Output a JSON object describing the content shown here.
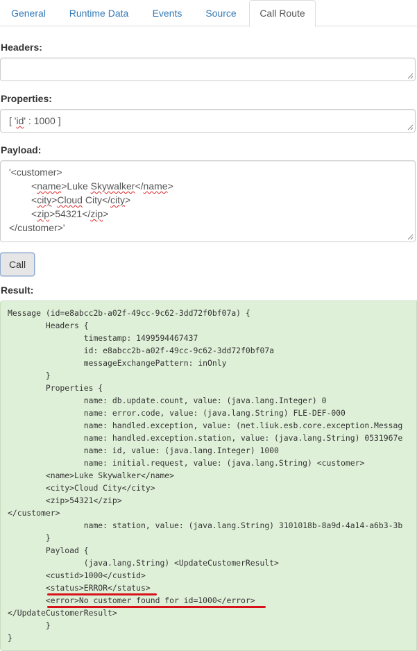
{
  "tabs": [
    {
      "label": "General"
    },
    {
      "label": "Runtime Data"
    },
    {
      "label": "Events"
    },
    {
      "label": "Source"
    },
    {
      "label": "Call Route"
    }
  ],
  "active_tab": "Call Route",
  "headers": {
    "label": "Headers:",
    "value": ""
  },
  "properties": {
    "label": "Properties:",
    "value_pre": "[ '",
    "value_key": "id",
    "value_post": "' : 1000 ]"
  },
  "payload": {
    "label": "Payload:",
    "lines": [
      [
        "'<customer>"
      ],
      [
        "<",
        "name",
        ">Luke ",
        "Skywalker",
        "</",
        "name",
        ">"
      ],
      [
        "<",
        "city",
        ">",
        "Cloud",
        " City</",
        "city",
        ">"
      ],
      [
        "<",
        "zip",
        ">54321</",
        "zip",
        ">"
      ],
      [
        "</customer>'"
      ]
    ]
  },
  "call_button": "Call",
  "result": {
    "label": "Result:",
    "lines": [
      "Message (id=e8abcc2b-a02f-49cc-9c62-3dd72f0bf07a) {",
      "        Headers {",
      "                timestamp: 1499594467437",
      "                id: e8abcc2b-a02f-49cc-9c62-3dd72f0bf07a",
      "                messageExchangePattern: inOnly",
      "        }",
      "        Properties {",
      "                name: db.update.count, value: (java.lang.Integer) 0",
      "                name: error.code, value: (java.lang.String) FLE-DEF-000",
      "                name: handled.exception, value: (net.liuk.esb.core.exception.Messag",
      "                name: handled.exception.station, value: (java.lang.String) 0531967e",
      "                name: id, value: (java.lang.Integer) 1000",
      "                name: initial.request, value: (java.lang.String) <customer>",
      "        <name>Luke Skywalker</name>",
      "        <city>Cloud City</city>",
      "        <zip>54321</zip>",
      "</customer>",
      "                name: station, value: (java.lang.String) 3101018b-8a9d-4a14-a6b3-3b",
      "        }",
      "        Payload {",
      "                (java.lang.String) <UpdateCustomerResult>",
      "        <custid>1000</custid>",
      "        <status>ERROR</status>",
      "        <error>No customer found for id=1000</error>",
      "</UpdateCustomerResult>",
      "        }",
      "}"
    ]
  },
  "colors": {
    "link": "#337ab7",
    "result_bg": "#dff0d8",
    "highlight": "#d8121b"
  }
}
